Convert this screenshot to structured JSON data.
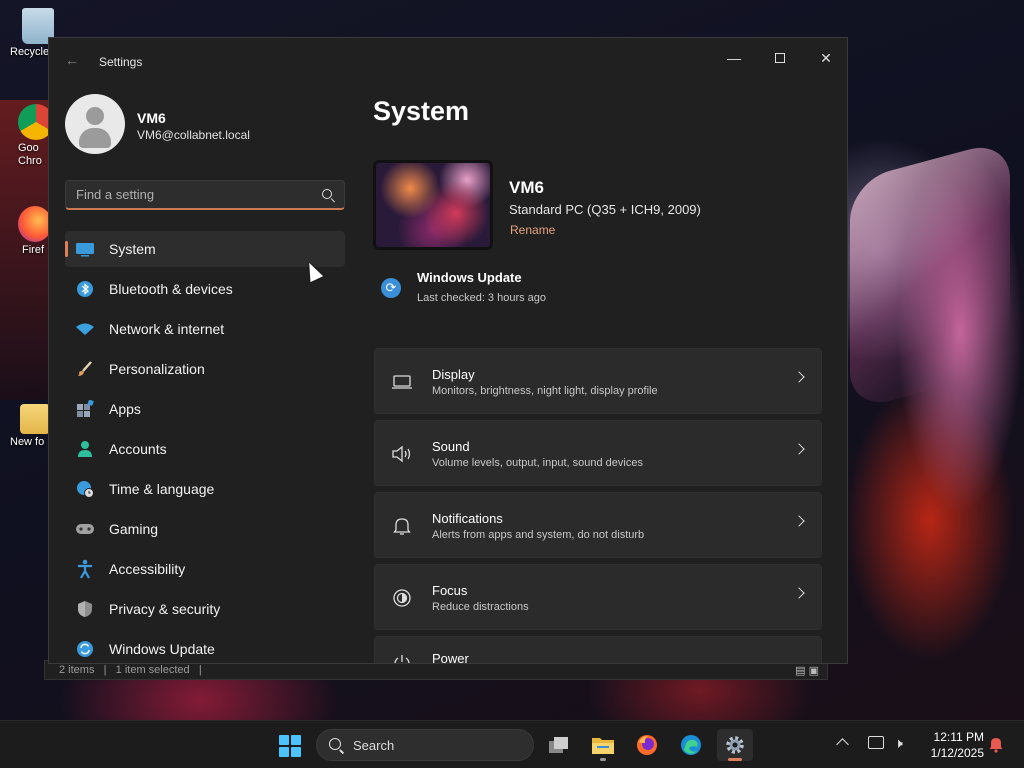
{
  "desktop": {
    "icons": [
      {
        "label": "Recycle",
        "icon": "recycle-bin-icon"
      },
      {
        "label": "Goo",
        "label2": "Chro",
        "icon": "chrome-icon"
      },
      {
        "label": "Firef",
        "icon": "firefox-icon"
      },
      {
        "label": "New fo",
        "icon": "folder-icon"
      }
    ]
  },
  "background_window": {
    "status_items": "2 items",
    "status_selected": "1 item selected",
    "separator": "|"
  },
  "window": {
    "title": "Settings",
    "back_icon": "arrow-left-icon",
    "controls": {
      "minimize": "—",
      "close": "✕"
    }
  },
  "profile": {
    "name": "VM6",
    "email": "VM6@collabnet.local"
  },
  "search": {
    "placeholder": "Find a setting"
  },
  "nav": {
    "items": [
      {
        "label": "System",
        "icon": "monitor-icon",
        "color": "#3a9bdc"
      },
      {
        "label": "Bluetooth & devices",
        "icon": "bluetooth-icon",
        "color": "#3a9bdc"
      },
      {
        "label": "Network & internet",
        "icon": "wifi-icon",
        "color": "#3aa0e0"
      },
      {
        "label": "Personalization",
        "icon": "brush-icon",
        "color": "#e0a05a"
      },
      {
        "label": "Apps",
        "icon": "apps-icon",
        "color": "#8a9ab0"
      },
      {
        "label": "Accounts",
        "icon": "person-icon",
        "color": "#2fbf9a"
      },
      {
        "label": "Time & language",
        "icon": "globe-clock-icon",
        "color": "#3a9bdc"
      },
      {
        "label": "Gaming",
        "icon": "gamepad-icon",
        "color": "#9a9a9a"
      },
      {
        "label": "Accessibility",
        "icon": "accessibility-icon",
        "color": "#3a9bdc"
      },
      {
        "label": "Privacy & security",
        "icon": "shield-icon",
        "color": "#8a8a8a"
      },
      {
        "label": "Windows Update",
        "icon": "sync-icon",
        "color": "#3a9bdc"
      }
    ]
  },
  "main": {
    "title": "System",
    "device": {
      "name": "VM6",
      "model": "Standard PC (Q35 + ICH9, 2009)",
      "rename": "Rename"
    },
    "update": {
      "title": "Windows Update",
      "subtitle": "Last checked: 3 hours ago"
    },
    "cards": [
      {
        "title": "Display",
        "subtitle": "Monitors, brightness, night light, display profile",
        "icon": "laptop-icon"
      },
      {
        "title": "Sound",
        "subtitle": "Volume levels, output, input, sound devices",
        "icon": "speaker-icon"
      },
      {
        "title": "Notifications",
        "subtitle": "Alerts from apps and system, do not disturb",
        "icon": "bell-icon"
      },
      {
        "title": "Focus",
        "subtitle": "Reduce distractions",
        "icon": "focus-icon"
      },
      {
        "title": "Power",
        "subtitle": "",
        "icon": "power-icon"
      }
    ]
  },
  "taskbar": {
    "search_label": "Search",
    "time": "12:11 PM",
    "date": "1/12/2025",
    "accent": "#4cc2ff"
  }
}
